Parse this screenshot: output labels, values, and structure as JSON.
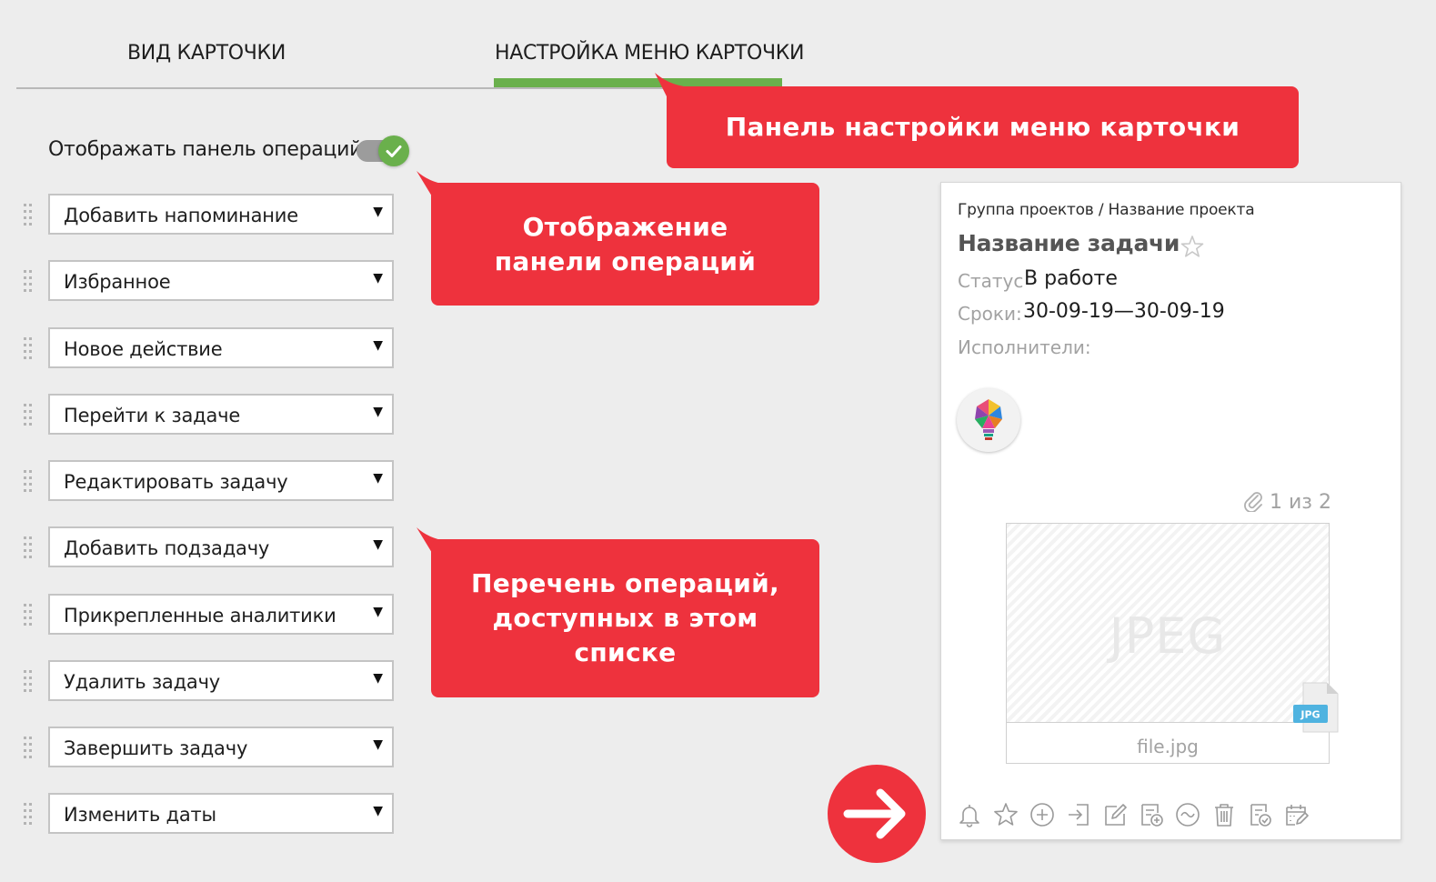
{
  "tabs": {
    "view": "ВИД КАРТОЧКИ",
    "menu": "НАСТРОЙКА МЕНЮ КАРТОЧКИ"
  },
  "toggle": {
    "label": "Отображать панель операций",
    "enabled": true
  },
  "operations": [
    {
      "label": "Добавить напоминание"
    },
    {
      "label": "Избранное"
    },
    {
      "label": "Новое действие"
    },
    {
      "label": "Перейти к задаче"
    },
    {
      "label": "Редактировать задачу"
    },
    {
      "label": "Добавить подзадачу"
    },
    {
      "label": "Прикрепленные аналитики"
    },
    {
      "label": "Удалить задачу"
    },
    {
      "label": "Завершить задачу"
    },
    {
      "label": "Изменить даты"
    }
  ],
  "callouts": {
    "menu_panel": "Панель настройки меню карточки",
    "ops_panel_line1": "Отображение",
    "ops_panel_line2": "панели операций",
    "ops_list_line1": "Перечень операций,",
    "ops_list_line2": "доступных в этом",
    "ops_list_line3": "списке"
  },
  "card": {
    "breadcrumb": "Группа проектов / Название проекта",
    "title": "Название задачи",
    "status_label": "Статус",
    "status_value": "В работе",
    "dates_label": "Сроки:",
    "dates_value": "30-09-19—30-09-19",
    "assignees_label": "Исполнители:",
    "attachment_counter": "1 из 2",
    "attachment_watermark": "JPEG",
    "attachment_name": "file.jpg",
    "file_badge": "JPG"
  },
  "colors": {
    "accent_red": "#ee323d",
    "accent_green": "#6ab04c",
    "background": "#ededed"
  },
  "icons": [
    "bell-icon",
    "star-icon",
    "plus-circle-icon",
    "goto-icon",
    "edit-icon",
    "add-subtask-icon",
    "analytics-icon",
    "trash-icon",
    "complete-task-icon",
    "calendar-edit-icon"
  ]
}
